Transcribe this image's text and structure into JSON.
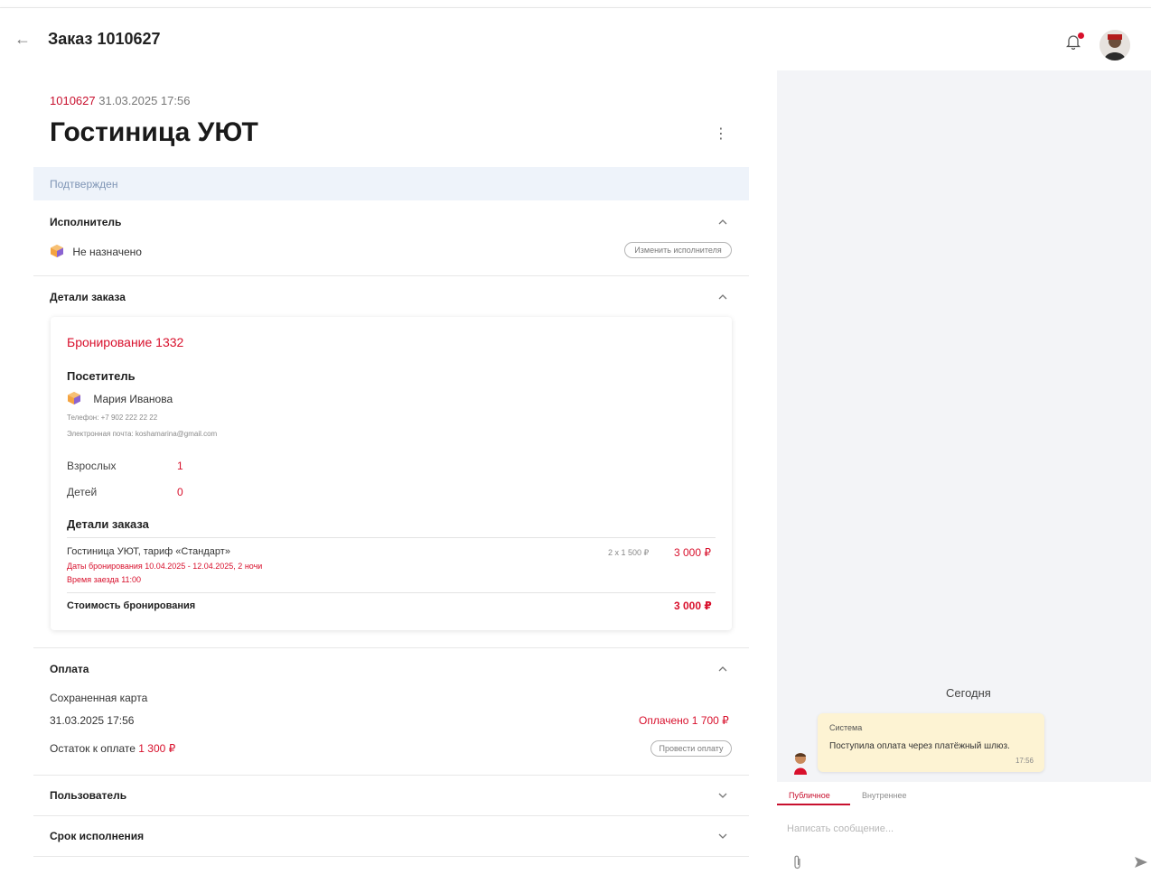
{
  "header": {
    "back_icon": "arrow-left-icon",
    "title": "Заказ 1010627",
    "notification_icon": "bell-icon",
    "accent": "#d8102c"
  },
  "order": {
    "number": "1010627",
    "datetime": "31.03.2025 17:56",
    "hotel_name": "Гостиница УЮТ",
    "status": "Подтвержден"
  },
  "executor": {
    "title": "Исполнитель",
    "value": "Не назначено",
    "change_label": "Изменить исполнителя"
  },
  "details": {
    "title": "Детали заказа",
    "booking_title": "Бронирование 1332",
    "visitor_heading": "Посетитель",
    "visitor_name": "Мария Иванова",
    "phone": "Телефон: +7 902 222 22 22",
    "email": "Электронная почта: koshamarina@gmail.com",
    "adults_label": "Взрослых",
    "adults_value": "1",
    "children_label": "Детей",
    "children_value": "0",
    "order_details_heading": "Детали заказа",
    "line_item": {
      "name": "Гостиница УЮТ, тариф «Стандарт»",
      "dates": "Даты бронирования 10.04.2025 - 12.04.2025, 2 ночи",
      "checkin": "Время заезда 11:00",
      "qty_price": "2 x 1 500 ₽",
      "total": "3 000 ₽"
    },
    "booking_cost_label": "Стоимость бронирования",
    "booking_cost_value": "3 000 ₽"
  },
  "payment": {
    "title": "Оплата",
    "method": "Сохраненная карта",
    "date": "31.03.2025 17:56",
    "paid": "Оплачено 1 700 ₽",
    "remaining_label": "Остаток к оплате",
    "remaining_value": "1 300 ₽",
    "pay_button": "Провести оплату"
  },
  "collapsed_sections": {
    "user": "Пользователь",
    "deadline": "Срок исполнения"
  },
  "chat": {
    "date_label": "Сегодня",
    "message": {
      "sender": "Система",
      "text": "Поступила оплата через платёжный шлюз.",
      "time": "17:56"
    },
    "tabs": [
      "Публичное",
      "Внутреннее"
    ],
    "input_placeholder": "Написать сообщение..."
  }
}
